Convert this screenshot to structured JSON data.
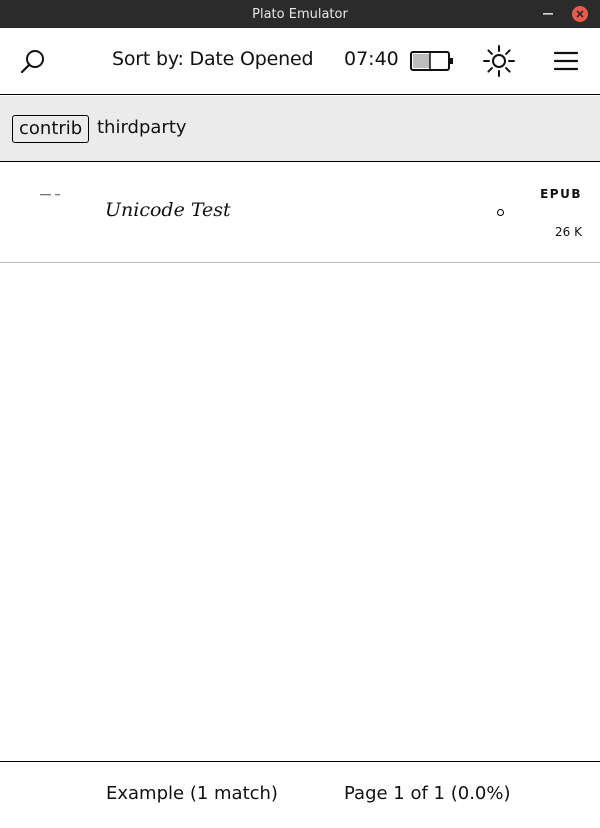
{
  "window": {
    "title": "Plato Emulator",
    "close_color": "#e95c4b"
  },
  "topbar": {
    "search_icon": "search-icon",
    "sort_label": "Sort by: Date Opened",
    "clock": "07:40",
    "battery_icon": "battery-icon",
    "battery_level": 0.45,
    "frontlight_icon": "sun-icon",
    "menu_icon": "hamburger-menu-icon"
  },
  "navbar": {
    "tags": [
      {
        "label": "contrib",
        "selected": true
      },
      {
        "label": "thirdparty",
        "selected": false
      }
    ]
  },
  "books": [
    {
      "title": "Unicode Test",
      "format": "EPUB",
      "size": "26 K",
      "status_icon": "unread-circle-icon"
    }
  ],
  "bottombar": {
    "match_label": "Example (1 match)",
    "page_label": "Page 1 of 1 (0.0%)"
  }
}
